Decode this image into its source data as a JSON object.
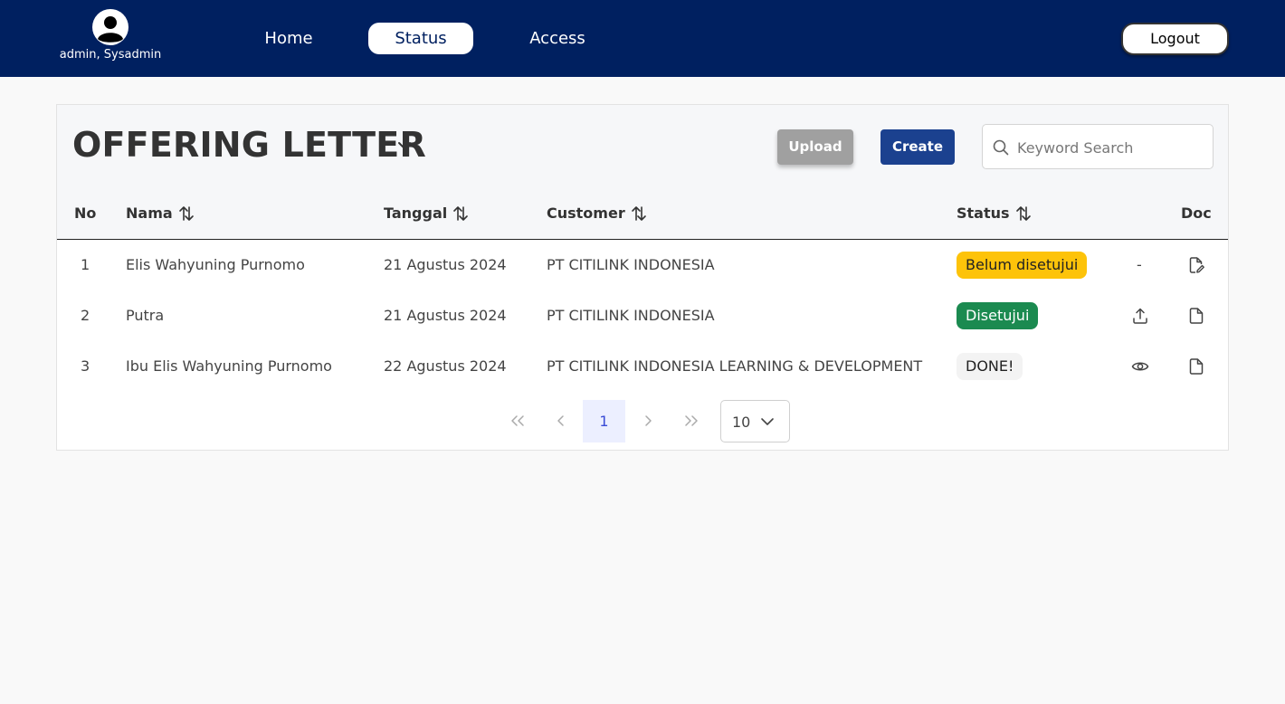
{
  "user": {
    "name": "admin, Sysadmin",
    "icon": "user-avatar-icon"
  },
  "nav": {
    "home": "Home",
    "status": "Status",
    "access": "Access",
    "active": "Status",
    "logout": "Logout"
  },
  "page": {
    "title": "OFFERING LETTER",
    "upload_label": "Upload",
    "create_label": "Create",
    "search_placeholder": "Keyword Search"
  },
  "table": {
    "headers": {
      "no": "No",
      "nama": "Nama",
      "tanggal": "Tanggal",
      "customer": "Customer",
      "status": "Status",
      "doc": "Doc"
    },
    "rows": [
      {
        "no": "1",
        "nama": "Elis Wahyuning Purnomo",
        "tanggal": "21 Agustus 2024",
        "customer": "PT CITILINK INDONESIA",
        "status": "Belum disetujui",
        "action": "-",
        "doc_icon": "file-edit-icon"
      },
      {
        "no": "2",
        "nama": "Putra",
        "tanggal": "21 Agustus 2024",
        "customer": "PT CITILINK INDONESIA",
        "status": "Disetujui",
        "action_icon": "upload-icon",
        "doc_icon": "file-icon"
      },
      {
        "no": "3",
        "nama": "Ibu Elis Wahyuning Purnomo",
        "tanggal": "22 Agustus 2024",
        "customer": "PT CITILINK INDONESIA LEARNING & DEVELOPMENT",
        "status": "DONE!",
        "action_icon": "eye-icon",
        "doc_icon": "file-icon"
      }
    ]
  },
  "pagination": {
    "current_page": "1",
    "page_size": "10"
  },
  "colors": {
    "header_bg": "#002060",
    "primary": "#1b418f",
    "status_pending": "#fdc30a",
    "status_approved": "#1b8a50",
    "status_done": "#f3f3f3",
    "upload_disabled": "#a0a0a0"
  }
}
